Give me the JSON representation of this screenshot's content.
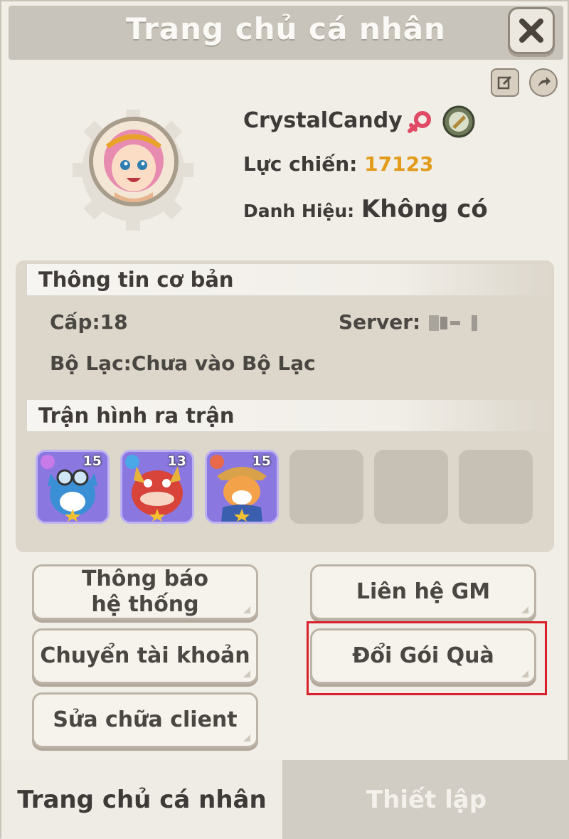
{
  "window": {
    "title": "Trang chủ cá nhân"
  },
  "profile": {
    "name": "CrystalCandy",
    "power_label": "Lực chiến:",
    "power_value": "17123",
    "title_label": "Danh Hiệu:",
    "title_value": "Không có"
  },
  "basic_info": {
    "heading": "Thông tin cơ bản",
    "level": "Cấp:18",
    "server_label": "Server:",
    "tribe": "Bộ Lạc:Chưa vào Bộ Lạc"
  },
  "lineup": {
    "heading": "Trận hình ra trận",
    "heroes": [
      {
        "level": "15"
      },
      {
        "level": "13"
      },
      {
        "level": "15"
      }
    ]
  },
  "buttons": {
    "system_notice": "Thông báo hệ thống",
    "contact_gm": "Liên hệ GM",
    "switch_account": "Chuyển tài khoản",
    "redeem_gift": "Đổi Gói Quà",
    "repair_client": "Sửa chữa client"
  },
  "tabs": {
    "personal": "Trang chủ cá nhân",
    "settings": "Thiết lập"
  },
  "colors": {
    "accent_power": "#e29b1a",
    "highlight_border": "#d8202a"
  }
}
